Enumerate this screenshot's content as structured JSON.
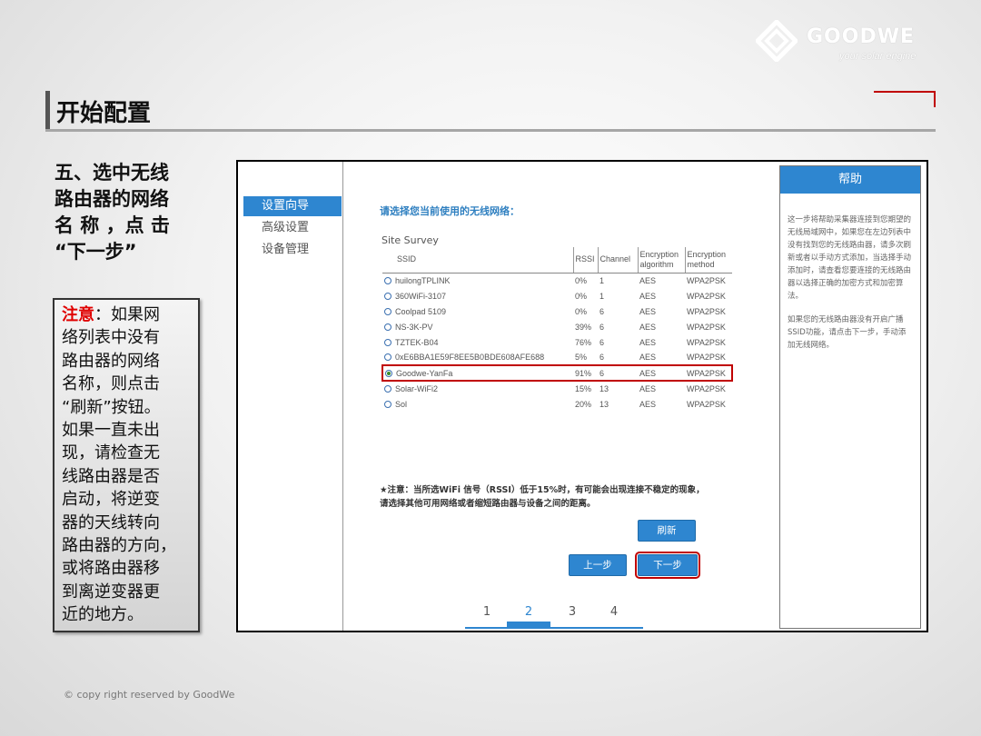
{
  "logo": {
    "brand": "GOODWE",
    "tagline": "your solar engine"
  },
  "slide": {
    "title": "开始配置",
    "step_lines": [
      "五、选中无线",
      "路由器的网络",
      "名 称 ，点 击",
      "“下一步”"
    ],
    "note_label": "注意",
    "note_lines": [
      "：如果网",
      "络列表中没有",
      "路由器的网络",
      "名称，则点击",
      "“刷新”按钮。",
      "如果一直未出",
      "现，请检查无",
      "线路由器是否",
      "启动，将逆变",
      "器的天线转向",
      "路由器的方向，",
      "或将路由器移",
      "到离逆变器更",
      "近的地方。"
    ],
    "copyright": "© copy right reserved by GoodWe"
  },
  "side_nav": {
    "items": [
      {
        "label": "设置向导",
        "active": true
      },
      {
        "label": "高级设置",
        "active": false
      },
      {
        "label": "设备管理",
        "active": false
      }
    ]
  },
  "wizard": {
    "prompt": "请选择您当前使用的无线网络：",
    "survey_title": "Site Survey",
    "columns": [
      "SSID",
      "RSSI",
      "Channel",
      "Encryption algorithm",
      "Encryption method"
    ],
    "rows": [
      {
        "ssid": "huilongTPLINK",
        "rssi": "0%",
        "channel": "1",
        "algorithm": "AES",
        "method": "WPA2PSK",
        "selected": false
      },
      {
        "ssid": "360WiFi-3107",
        "rssi": "0%",
        "channel": "1",
        "algorithm": "AES",
        "method": "WPA2PSK",
        "selected": false
      },
      {
        "ssid": "Coolpad 5109",
        "rssi": "0%",
        "channel": "6",
        "algorithm": "AES",
        "method": "WPA2PSK",
        "selected": false
      },
      {
        "ssid": "NS-3K-PV",
        "rssi": "39%",
        "channel": "6",
        "algorithm": "AES",
        "method": "WPA2PSK",
        "selected": false
      },
      {
        "ssid": "TZTEK-B04",
        "rssi": "76%",
        "channel": "6",
        "algorithm": "AES",
        "method": "WPA2PSK",
        "selected": false
      },
      {
        "ssid": "0xE6BBA1E59F8EE5B0BDE608AFE688",
        "rssi": "5%",
        "channel": "6",
        "algorithm": "AES",
        "method": "WPA2PSK",
        "selected": false
      },
      {
        "ssid": "Goodwe-YanFa",
        "rssi": "91%",
        "channel": "6",
        "algorithm": "AES",
        "method": "WPA2PSK",
        "selected": true
      },
      {
        "ssid": "Solar-WiFi2",
        "rssi": "15%",
        "channel": "13",
        "algorithm": "AES",
        "method": "WPA2PSK",
        "selected": false
      },
      {
        "ssid": "Sol",
        "rssi": "20%",
        "channel": "13",
        "algorithm": "AES",
        "method": "WPA2PSK",
        "selected": false
      }
    ],
    "warning_line1": "★注意：当所选WiFi 信号（RSSI）低于15%时，有可能会出现连接不稳定的现象，",
    "warning_line2": "请选择其他可用网络或者缩短路由器与设备之间的距离。",
    "refresh_label": "刷新",
    "prev_label": "上一步",
    "next_label": "下一步",
    "pages": [
      "1",
      "2",
      "3",
      "4"
    ],
    "current_page": "2"
  },
  "help": {
    "title": "帮助",
    "paragraph1": "这一步将帮助采集器连接到您期望的无线局域网中，如果您在左边列表中没有找到您的无线路由器，请多次刷新或者以手动方式添加，当选择手动添加时，请查看您要连接的无线路由器以选择正确的加密方式和加密算法。",
    "paragraph2": "如果您的无线路由器没有开启广播SSID功能，请点击下一步，手动添加无线网络。"
  },
  "colors": {
    "accent": "#2e86d0",
    "highlight": "#c00000",
    "note_red": "#e00000"
  }
}
